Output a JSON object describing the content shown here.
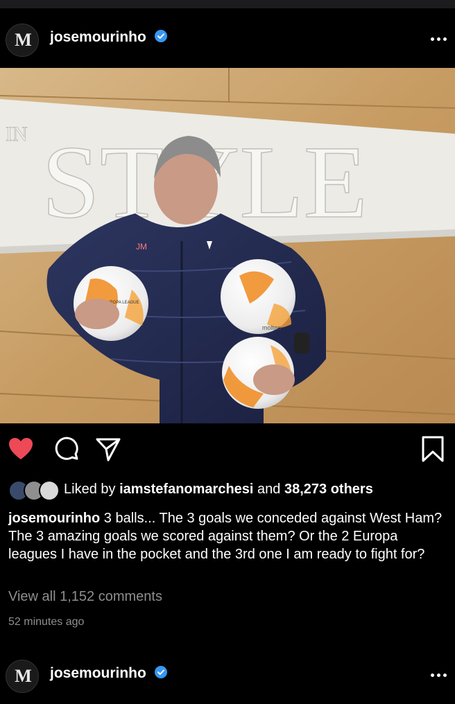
{
  "post": {
    "username": "josemourinho",
    "avatar_monogram": "M",
    "photo": {
      "wall_text_small": "IN",
      "wall_text_large": "STYLE",
      "jacket_initials": "JM",
      "ball_print": "EUROPA LEAGUE",
      "ball_brand": "molten"
    },
    "likes": {
      "prefix": "Liked by",
      "first_liker": "iamstefanomarchesi",
      "joiner": "and",
      "others": "38,273 others"
    },
    "caption": {
      "username": "josemourinho",
      "text": "3 balls... The 3 goals we conceded against West Ham? The 3 amazing goals we scored against them? Or the 2 Europa leagues I have in the pocket and the 3rd one I am ready to fight for?"
    },
    "view_comments": "View all 1,152 comments",
    "timestamp": "52 minutes ago"
  },
  "next_post": {
    "username": "josemourinho",
    "avatar_monogram": "M"
  },
  "icons": {
    "like": "heart-icon",
    "comment": "comment-bubble-icon",
    "share": "paper-plane-icon",
    "save": "bookmark-icon",
    "more": "more-dots-icon",
    "verified": "verified-badge-icon"
  },
  "colors": {
    "background": "#000000",
    "liked_heart": "#ed4956",
    "verified_badge": "#3897f0",
    "secondary_text": "#8e8e8e"
  }
}
